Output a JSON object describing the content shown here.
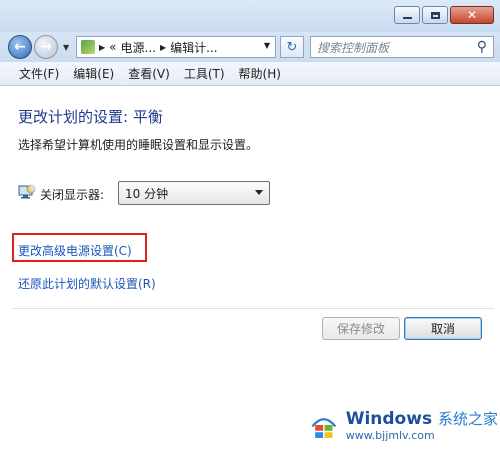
{
  "address": {
    "crumbs": [
      "«",
      "电源...",
      "编辑计..."
    ],
    "search_placeholder": "搜索控制面板"
  },
  "menu": [
    "文件(F)",
    "编辑(E)",
    "查看(V)",
    "工具(T)",
    "帮助(H)"
  ],
  "page": {
    "title": "更改计划的设置: 平衡",
    "description": "选择希望计算机使用的睡眠设置和显示设置。",
    "display_off_label": "关闭显示器:",
    "display_off_value": "10 分钟",
    "advanced_link": "更改高级电源设置(C)",
    "restore_link": "还原此计划的默认设置(R)"
  },
  "buttons": {
    "save": "保存修改",
    "cancel": "取消"
  },
  "watermark": {
    "title": "Windows",
    "title_cn": "系统之家",
    "url": "www.bjjmlv.com"
  },
  "colors": {
    "title_blue": "#1e3a8c",
    "link_blue": "#1b56b8",
    "highlight_red": "#e02020"
  }
}
